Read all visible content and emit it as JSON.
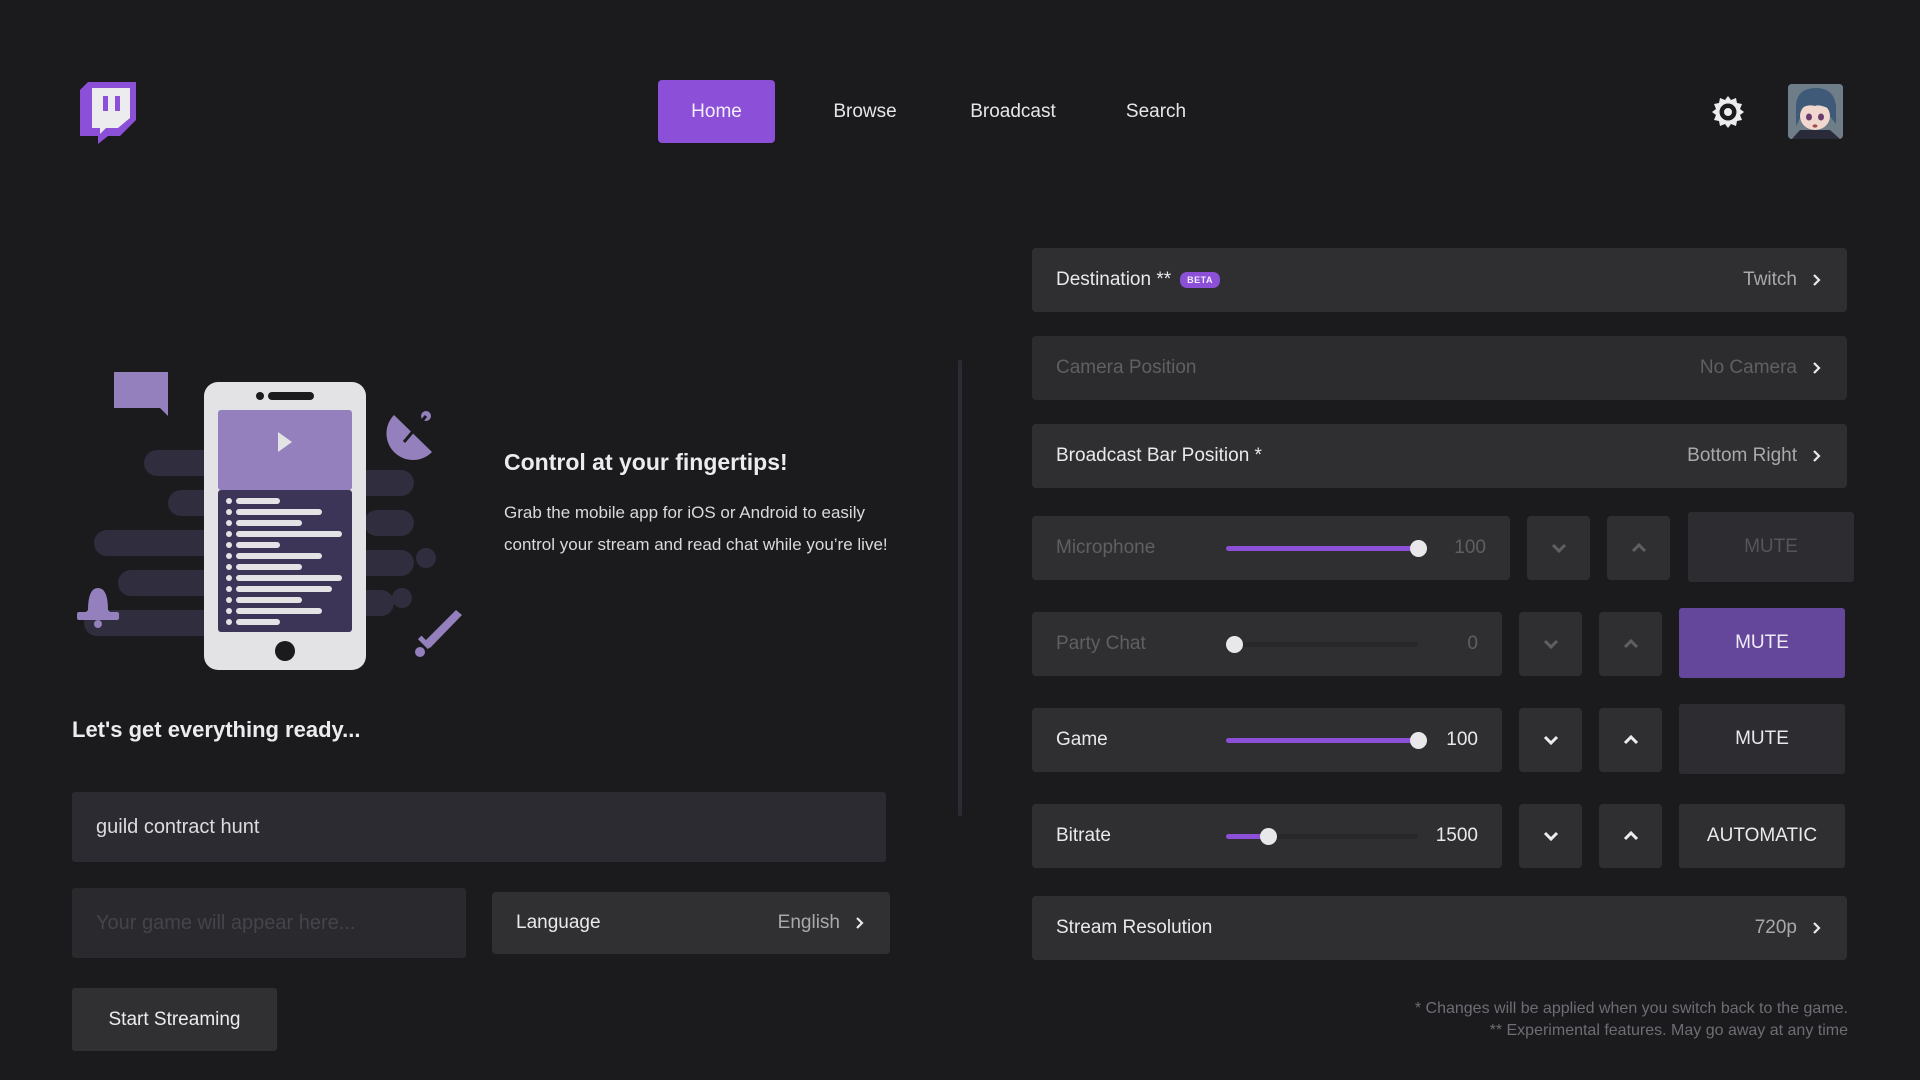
{
  "colors": {
    "accent": "#8b4fd8",
    "accent_active": "#64479a",
    "background": "#1b1b1d",
    "row_bg": "#2f2f31"
  },
  "header": {
    "logo_icon": "twitch-glitch-logo",
    "nav": [
      {
        "label": "Home",
        "active": true
      },
      {
        "label": "Browse",
        "active": false
      },
      {
        "label": "Broadcast",
        "active": false
      },
      {
        "label": "Search",
        "active": false
      }
    ],
    "settings_icon": "gear-icon",
    "avatar_icon": "user-avatar"
  },
  "promo": {
    "title": "Control at your fingertips!",
    "body": "Grab the mobile app for iOS or Android to easily control your stream and read chat while you’re live!"
  },
  "setup": {
    "heading": "Let's get everything ready...",
    "stream_title_value": "guild contract hunt",
    "game_placeholder": "Your game will appear here...",
    "game_value": "",
    "language_label": "Language",
    "language_value": "English",
    "start_label": "Start Streaming"
  },
  "settings": {
    "destination": {
      "label": "Destination **",
      "badge": "BETA",
      "value": "Twitch"
    },
    "camera": {
      "label": "Camera Position",
      "value": "No Camera",
      "disabled": true
    },
    "bar_position": {
      "label": "Broadcast Bar Position *",
      "value": "Bottom Right"
    },
    "microphone": {
      "label": "Microphone",
      "value": "100",
      "level_percent": 100,
      "action": "MUTE",
      "disabled": true
    },
    "party_chat": {
      "label": "Party Chat",
      "value": "0",
      "level_percent": 0,
      "action": "MUTE",
      "muted": true,
      "disabled": true
    },
    "game": {
      "label": "Game",
      "value": "100",
      "level_percent": 100,
      "action": "MUTE"
    },
    "bitrate": {
      "label": "Bitrate",
      "value": "1500",
      "level_percent": 22,
      "action": "AUTOMATIC"
    },
    "resolution": {
      "label": "Stream Resolution",
      "value": "720p"
    }
  },
  "footnotes": {
    "line1": "* Changes will be applied when you switch back to the game.",
    "line2": "** Experimental features. May go away at any time"
  }
}
